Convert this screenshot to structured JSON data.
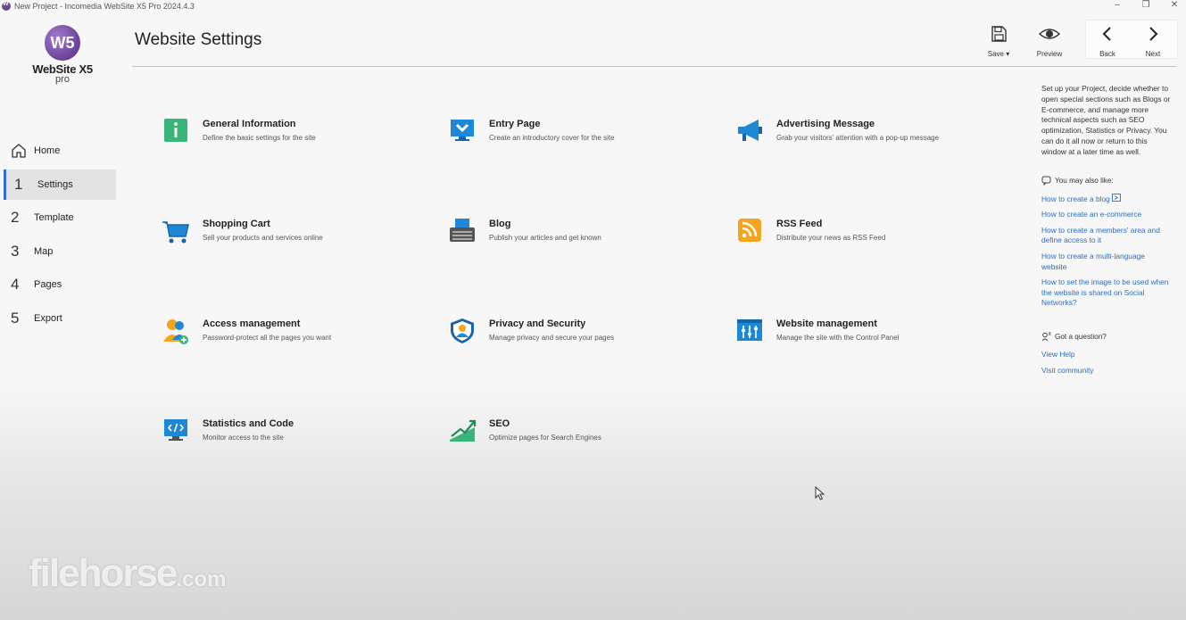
{
  "window": {
    "title": "New Project - Incomedia WebSite X5 Pro 2024.4.3",
    "controls": {
      "minimize": "–",
      "maximize": "❐",
      "close": "✕"
    }
  },
  "logo": {
    "mark": "W5",
    "name": "WebSite X5",
    "edition": "pro"
  },
  "nav": {
    "home": "Home",
    "items": [
      {
        "num": "1",
        "label": "Settings",
        "active": true
      },
      {
        "num": "2",
        "label": "Template"
      },
      {
        "num": "3",
        "label": "Map"
      },
      {
        "num": "4",
        "label": "Pages"
      },
      {
        "num": "5",
        "label": "Export"
      }
    ]
  },
  "header": {
    "title": "Website Settings"
  },
  "toolbar": {
    "save": "Save",
    "save_caret": "▾",
    "preview": "Preview",
    "back": "Back",
    "next": "Next"
  },
  "settings": [
    {
      "name": "General Information",
      "desc": "Define the basic settings for the site",
      "icon": "info-icon"
    },
    {
      "name": "Entry Page",
      "desc": "Create an introductory cover for the site",
      "icon": "entry-page-icon"
    },
    {
      "name": "Advertising Message",
      "desc": "Grab your visitors' attention with a pop-up message",
      "icon": "megaphone-icon"
    },
    {
      "name": "Shopping Cart",
      "desc": "Sell your products and services online",
      "icon": "cart-icon"
    },
    {
      "name": "Blog",
      "desc": "Publish your articles and get known",
      "icon": "typewriter-icon"
    },
    {
      "name": "RSS Feed",
      "desc": "Distribute your news as RSS Feed",
      "icon": "rss-icon"
    },
    {
      "name": "Access management",
      "desc": "Password-protect all the pages you want",
      "icon": "users-icon"
    },
    {
      "name": "Privacy and Security",
      "desc": "Manage privacy and secure your pages",
      "icon": "shield-user-icon"
    },
    {
      "name": "Website management",
      "desc": "Manage the site with the Control Panel",
      "icon": "control-panel-icon"
    },
    {
      "name": "Statistics and Code",
      "desc": "Monitor access to the site",
      "icon": "code-monitor-icon"
    },
    {
      "name": "SEO",
      "desc": "Optimize pages for Search Engines",
      "icon": "seo-chart-icon"
    }
  ],
  "side_panel": {
    "intro": "Set up your Project, decide whether to open special sections such as Blogs or E-commerce, and manage more technical aspects such as SEO optimization, Statistics or Privacy. You can do it all now or return to this window at a later time as well.",
    "also_like_title": "You may also like:",
    "also_like": [
      "How to create a blog",
      "How to create an e-commerce",
      "How to create a members' area and define access to it",
      "How to create a multi-language website",
      "How to set the image to be used when the website is shared  on Social Networks?"
    ],
    "question_title": "Got a question?",
    "question_links": [
      "View Help",
      "Visit community"
    ]
  },
  "watermark": {
    "main": "filehorse",
    "suffix": ".com"
  }
}
